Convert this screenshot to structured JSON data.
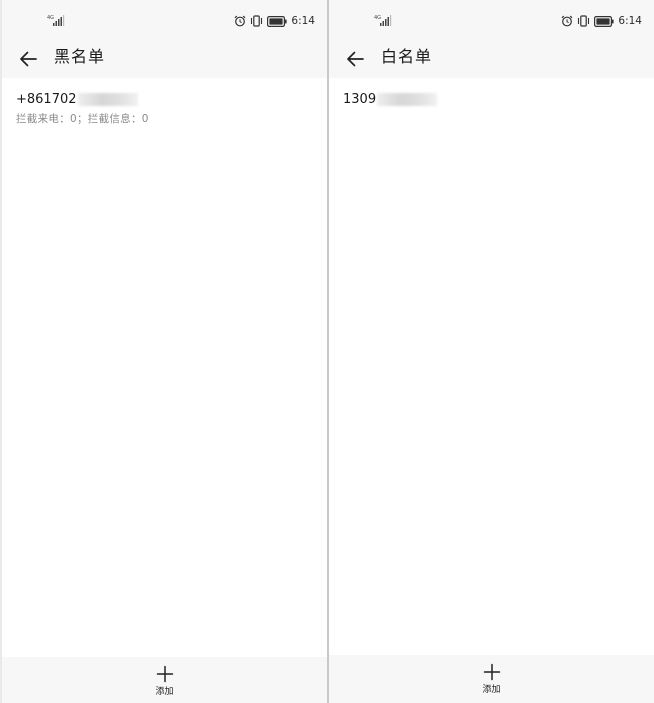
{
  "status_bar": {
    "network_label": "4G",
    "time": "6:14"
  },
  "blacklist_screen": {
    "title": "黑名单",
    "entries": [
      {
        "number_prefix": "+861702",
        "stats": "拦截来电：0；拦截信息：0"
      }
    ],
    "add_label": "添加"
  },
  "whitelist_screen": {
    "title": "白名单",
    "entries": [
      {
        "number_prefix": "1309"
      }
    ],
    "add_label": "添加"
  },
  "icons": {
    "signal": "signal-icon",
    "alarm": "alarm-icon",
    "vibrate": "vibrate-icon",
    "battery": "battery-icon",
    "back": "back-arrow-icon",
    "add": "plus-icon"
  }
}
